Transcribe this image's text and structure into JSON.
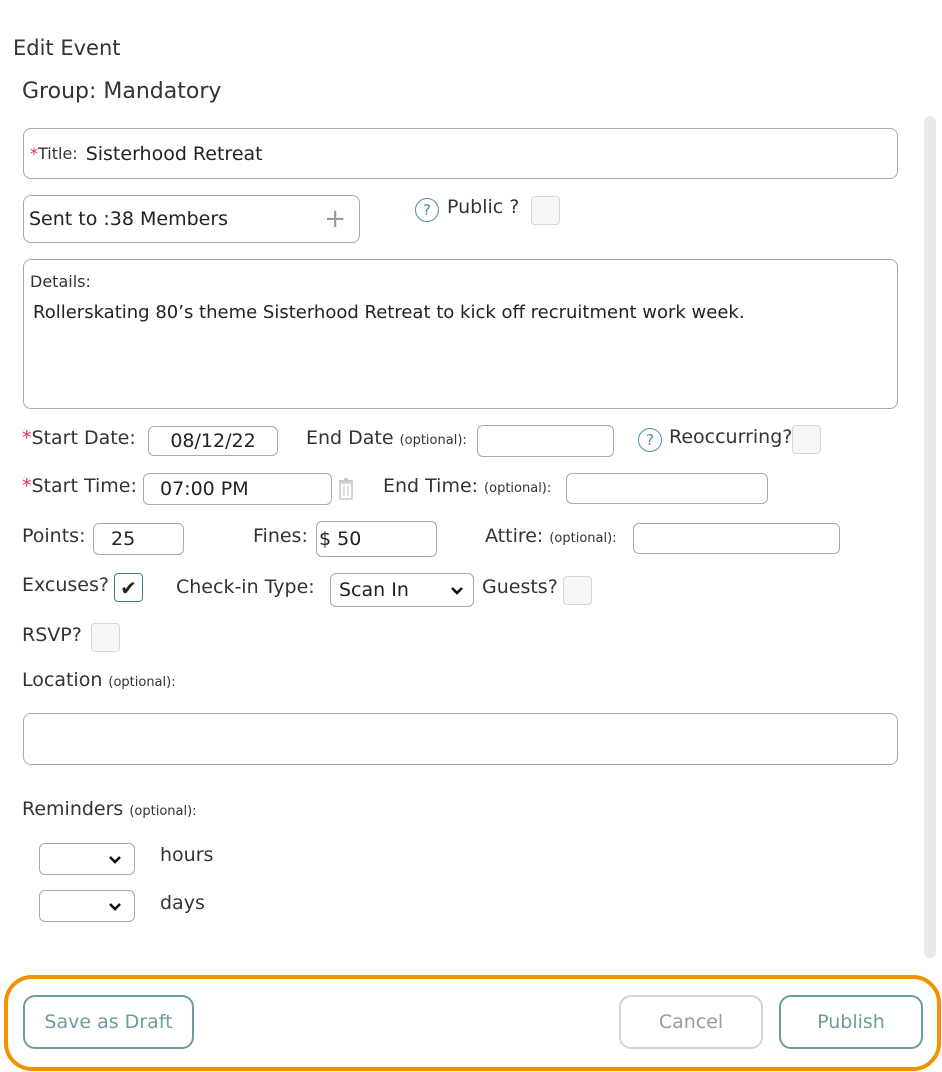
{
  "header": {
    "title": "Edit Event",
    "group_label": "Group:",
    "group_value": "Mandatory"
  },
  "form": {
    "title_label": "Title:",
    "title_value": "Sisterhood Retreat",
    "sent_to": "Sent to :38 Members",
    "public_label": "Public ?",
    "details_label": "Details:",
    "details_value": "Rollerskating 80’s theme Sisterhood Retreat to kick off recruitment work week.",
    "start_date_label": "Start Date:",
    "start_date_value": "08/12/22",
    "end_date_label": "End Date",
    "optional": "(optional):",
    "reoccurring_label": "Reoccurring?",
    "start_time_label": "Start Time:",
    "start_time_value": "07:00 PM",
    "end_time_label": "End Time:",
    "points_label": "Points:",
    "points_value": "25",
    "fines_label": "Fines:",
    "fines_value": "$ 50",
    "attire_label": "Attire:",
    "excuses_label": "Excuses?",
    "excuses_checked": true,
    "checkin_label": "Check-in Type:",
    "checkin_value": "Scan In",
    "guests_label": "Guests?",
    "rsvp_label": "RSVP?",
    "location_label": "Location",
    "reminders_label": "Reminders",
    "hours_label": "hours",
    "days_label": "days"
  },
  "footer": {
    "save_draft": "Save as Draft",
    "cancel": "Cancel",
    "publish": "Publish"
  },
  "colors": {
    "required": "#d9364a",
    "accent": "#6a9e9e",
    "highlight": "#f39200"
  }
}
